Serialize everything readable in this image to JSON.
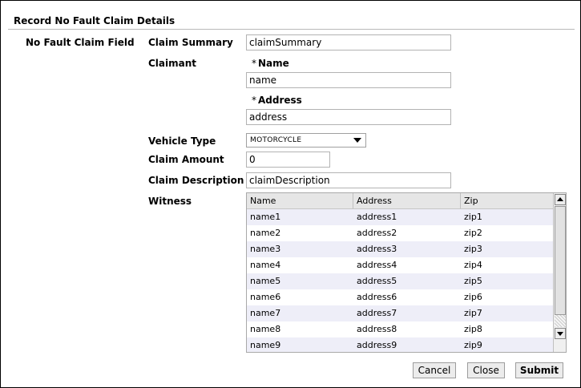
{
  "form": {
    "title": "Record No Fault Claim Details",
    "group_label": "No Fault Claim Field",
    "claim_summary": {
      "label": "Claim Summary",
      "value": "claimSummary"
    },
    "claimant": {
      "label": "Claimant",
      "name_label": "Name",
      "name_value": "name",
      "address_label": "Address",
      "address_value": "address",
      "required_marker": "*"
    },
    "vehicle_type": {
      "label": "Vehicle Type",
      "selected": "MOTORCYCLE"
    },
    "claim_amount": {
      "label": "Claim Amount",
      "value": "0"
    },
    "claim_description": {
      "label": "Claim Description",
      "value": "claimDescription"
    },
    "witness": {
      "label": "Witness",
      "columns": [
        "Name",
        "Address",
        "Zip"
      ],
      "rows": [
        [
          "name1",
          "address1",
          "zip1"
        ],
        [
          "name2",
          "address2",
          "zip2"
        ],
        [
          "name3",
          "address3",
          "zip3"
        ],
        [
          "name4",
          "address4",
          "zip4"
        ],
        [
          "name5",
          "address5",
          "zip5"
        ],
        [
          "name6",
          "address6",
          "zip6"
        ],
        [
          "name7",
          "address7",
          "zip7"
        ],
        [
          "name8",
          "address8",
          "zip8"
        ],
        [
          "name9",
          "address9",
          "zip9"
        ]
      ]
    }
  },
  "actions": {
    "cancel": "Cancel",
    "close": "Close",
    "submit": "Submit"
  },
  "colors": {
    "alt_row": "#eeeef8",
    "header": "#e6e6e6"
  }
}
